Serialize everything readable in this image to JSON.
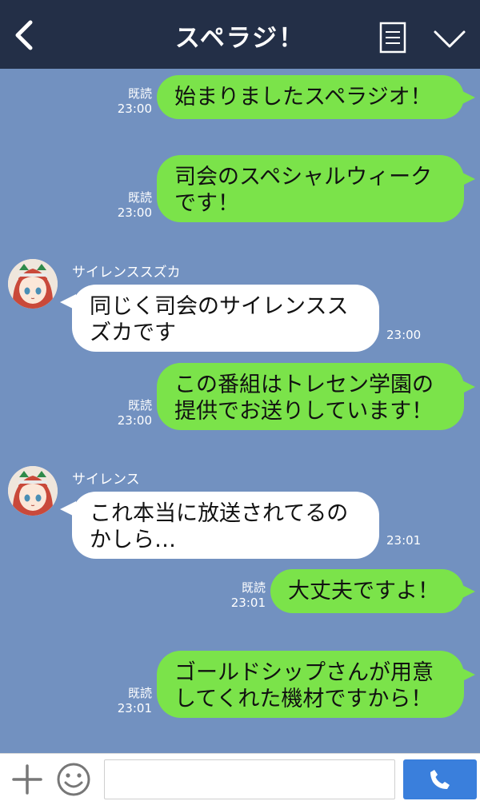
{
  "header": {
    "title": "スペラジ！",
    "back_icon": "chevron-left-icon",
    "menu_icon": "menu-list-icon",
    "collapse_icon": "chevron-down-icon",
    "background": "#232f47"
  },
  "chat": {
    "background": "#7291c0",
    "sent_bubble_color": "#7be34a",
    "received_bubble_color": "#ffffff",
    "messages": [
      {
        "type": "sent",
        "text": "始まりましたスペラジオ！",
        "read": "既読",
        "time": "23:00"
      },
      {
        "type": "sent",
        "text": "司会のスペシャルウィーク\nです！",
        "read": "既読",
        "time": "23:00"
      },
      {
        "type": "received",
        "sender": "サイレンススズカ",
        "text": "同じく司会のサイレンスス\nズカです",
        "time": "23:00"
      },
      {
        "type": "sent",
        "text": "この番組はトレセン学園の\n提供でお送りしています！",
        "read": "既読",
        "time": "23:00"
      },
      {
        "type": "received",
        "sender": "サイレンス",
        "text": "これ本当に放送されてるの\nかしら…",
        "time": "23:01"
      },
      {
        "type": "sent",
        "text": "大丈夫ですよ！",
        "read": "既読",
        "time": "23:01"
      },
      {
        "type": "sent",
        "text": "ゴールドシップさんが用意\nしてくれた機材ですから！",
        "read": "既読",
        "time": "23:01"
      }
    ]
  },
  "input_bar": {
    "plus_icon": "plus-icon",
    "emoji_icon": "smiley-icon",
    "message_value": "",
    "call_icon": "phone-icon",
    "call_color": "#3a7fdc"
  }
}
